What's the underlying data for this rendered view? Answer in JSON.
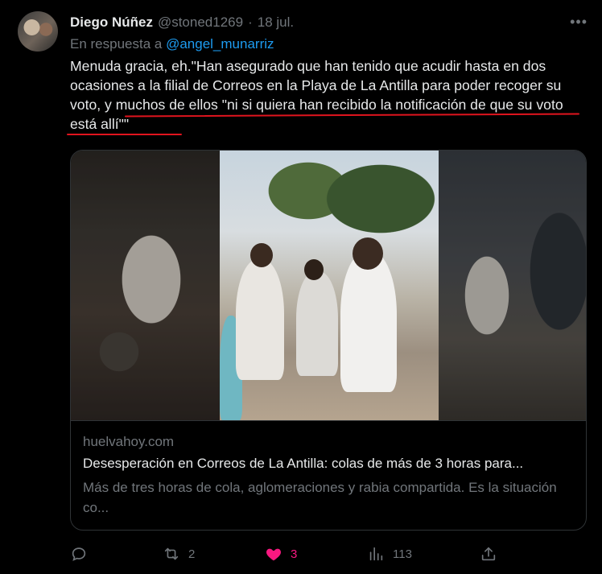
{
  "tweet": {
    "display_name": "Diego Núñez",
    "handle": "@stoned1269",
    "separator": "·",
    "date": "18 jul.",
    "reply_prefix": "En respuesta a ",
    "reply_to": "@angel_munarriz",
    "body": "Menuda gracia, eh.\"Han asegurado que han tenido que acudir hasta en dos ocasiones a la filial de Correos en la Playa de La Antilla para poder recoger su voto, y muchos de ellos \"ni si quiera han recibido la notificación de que su voto está allí\"\""
  },
  "card": {
    "domain": "huelvahoy.com",
    "headline": "Desesperación en Correos de La Antilla: colas de más de 3 horas para...",
    "description": "Más de tres horas de cola, aglomeraciones y rabia compartida. Es la situación co..."
  },
  "actions": {
    "replies": "",
    "retweets": "2",
    "likes": "3",
    "views": "113"
  },
  "colors": {
    "background": "#000000",
    "text": "#e7e9ea",
    "muted": "#71767b",
    "link": "#1d9bf0",
    "like": "#f91880",
    "annotation": "#e0141e"
  },
  "icons": [
    "more-icon",
    "reply-icon",
    "retweet-icon",
    "like-icon",
    "views-icon",
    "share-icon"
  ]
}
